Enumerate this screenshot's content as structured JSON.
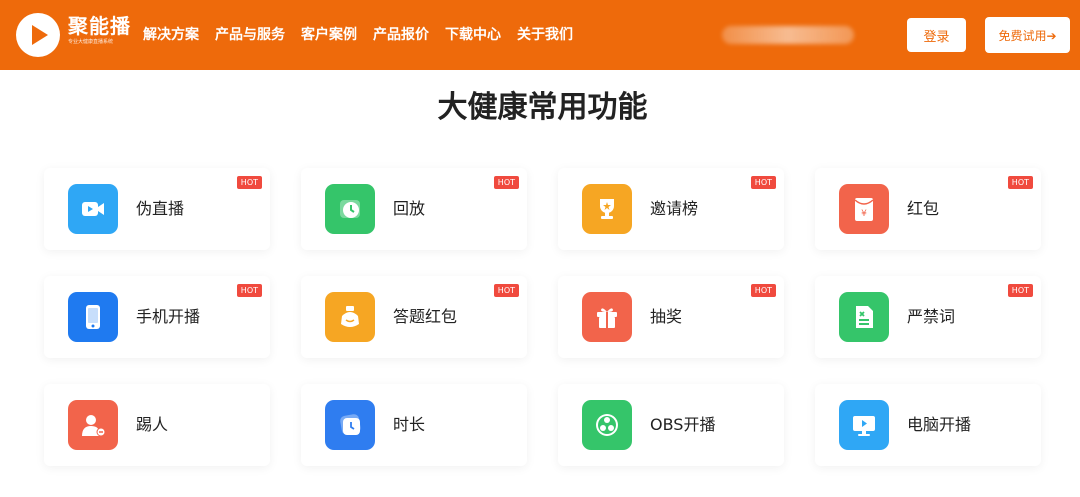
{
  "header": {
    "brand_name": "聚能播",
    "brand_subtitle": "专业大健康直播系统",
    "nav": [
      "解决方案",
      "产品与服务",
      "客户案例",
      "产品报价",
      "下载中心",
      "关于我们"
    ],
    "login_label": "登录",
    "trial_label": "免费试用➔",
    "accent_color": "#ee6a0b"
  },
  "section": {
    "title": "大健康常用功能"
  },
  "features": [
    {
      "label": "伪直播",
      "hot": "HOT",
      "icon": "video-camera-icon",
      "color": "#2fa7f5"
    },
    {
      "label": "回放",
      "hot": "HOT",
      "icon": "replay-icon",
      "color": "#35c56a"
    },
    {
      "label": "邀请榜",
      "hot": "HOT",
      "icon": "trophy-icon",
      "color": "#f6a623"
    },
    {
      "label": "红包",
      "hot": "HOT",
      "icon": "red-envelope-icon",
      "color": "#f2644b"
    },
    {
      "label": "手机开播",
      "hot": "HOT",
      "icon": "mobile-phone-icon",
      "color": "#1f7af0"
    },
    {
      "label": "答题红包",
      "hot": "HOT",
      "icon": "quiz-bag-icon",
      "color": "#f6a623"
    },
    {
      "label": "抽奖",
      "hot": "HOT",
      "icon": "gift-icon",
      "color": "#f2644b"
    },
    {
      "label": "严禁词",
      "hot": "HOT",
      "icon": "forbidden-words-icon",
      "color": "#35c56a"
    },
    {
      "label": "踢人",
      "hot": "",
      "icon": "kick-user-icon",
      "color": "#f2644b"
    },
    {
      "label": "时长",
      "hot": "",
      "icon": "clock-icon",
      "color": "#2f7df0"
    },
    {
      "label": "OBS开播",
      "hot": "",
      "icon": "obs-icon",
      "color": "#35c56a"
    },
    {
      "label": "电脑开播",
      "hot": "",
      "icon": "desktop-icon",
      "color": "#2fa7f5"
    }
  ]
}
